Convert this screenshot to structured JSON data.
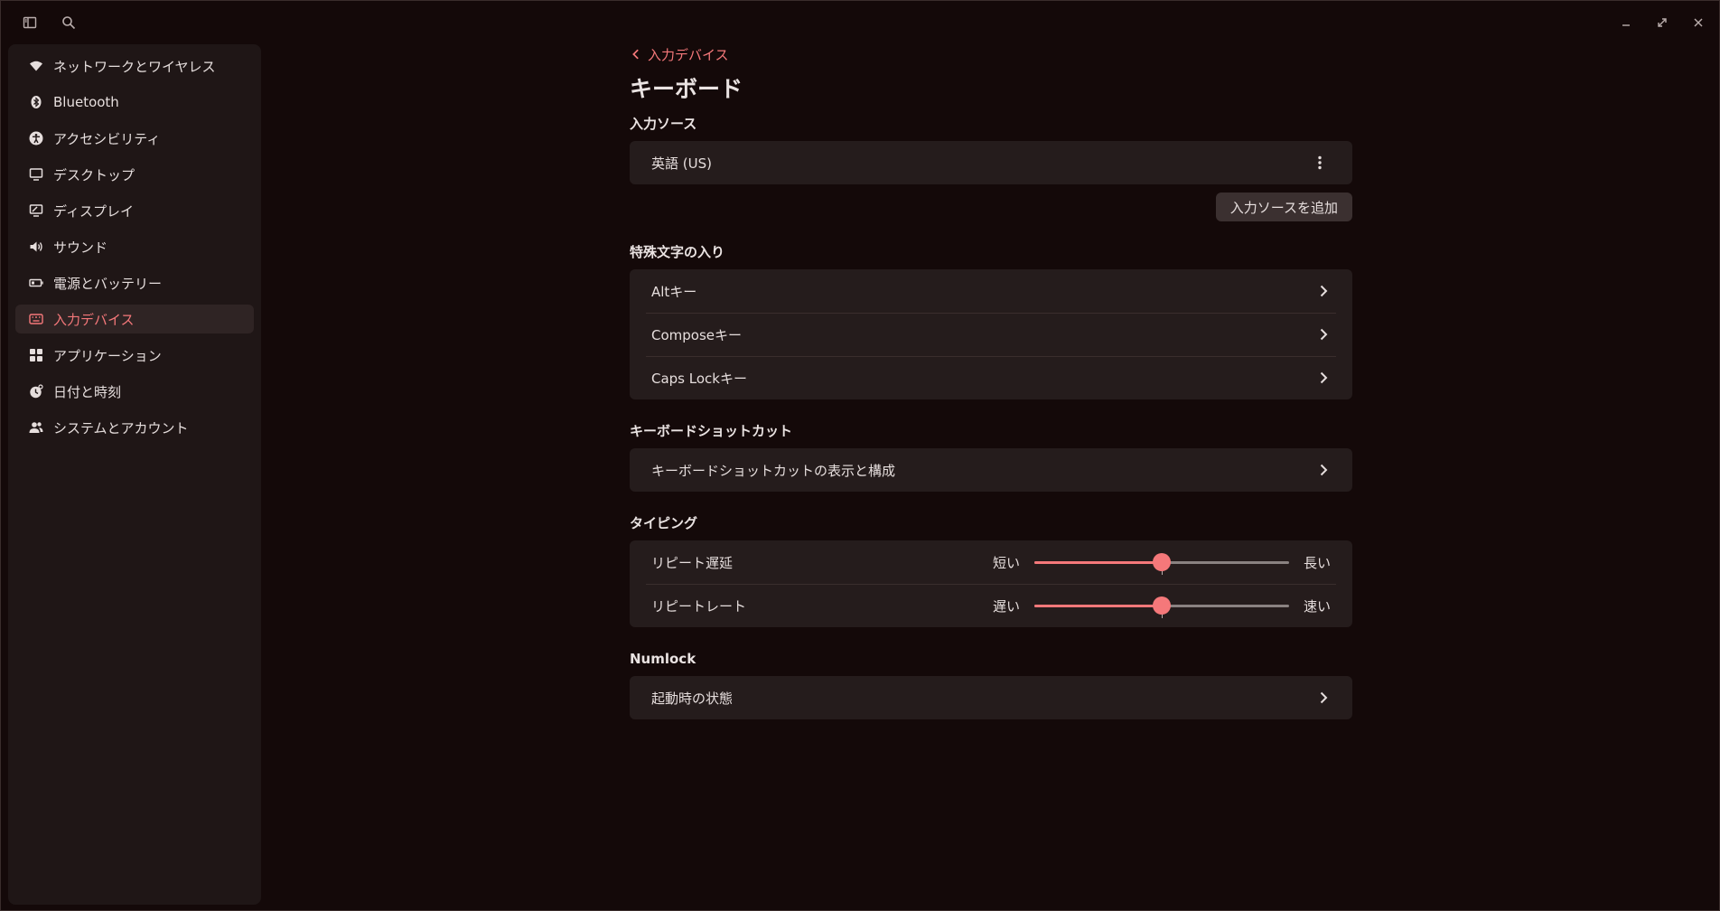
{
  "sidebar": {
    "items": [
      {
        "label": "ネットワークとワイヤレス",
        "icon": "wifi-icon"
      },
      {
        "label": "Bluetooth",
        "icon": "bluetooth-icon"
      },
      {
        "label": "アクセシビリティ",
        "icon": "accessibility-icon"
      },
      {
        "label": "デスクトップ",
        "icon": "desktop-icon"
      },
      {
        "label": "ディスプレイ",
        "icon": "display-icon"
      },
      {
        "label": "サウンド",
        "icon": "speaker-icon"
      },
      {
        "label": "電源とバッテリー",
        "icon": "battery-icon"
      },
      {
        "label": "入力デバイス",
        "icon": "keyboard-icon",
        "active": true
      },
      {
        "label": "アプリケーション",
        "icon": "apps-grid-icon"
      },
      {
        "label": "日付と時刻",
        "icon": "clock-icon"
      },
      {
        "label": "システムとアカウント",
        "icon": "users-icon"
      }
    ]
  },
  "colors": {
    "accent": "#f5787a",
    "background": "#140909",
    "sidebar": "#1f1616",
    "card": "#251c1c"
  },
  "header": {
    "back_label": "入力デバイス",
    "title": "キーボード"
  },
  "input_sources": {
    "title": "入力ソース",
    "items": [
      {
        "label": "英語 (US)"
      }
    ],
    "add_button": "入力ソースを追加"
  },
  "special_chars": {
    "title": "特殊文字の入り",
    "items": [
      {
        "label": "Altキー"
      },
      {
        "label": "Composeキー"
      },
      {
        "label": "Caps Lockキー"
      }
    ]
  },
  "shortcuts": {
    "title": "キーボードショットカット",
    "items": [
      {
        "label": "キーボードショットカットの表示と構成"
      }
    ]
  },
  "typing": {
    "title": "タイピング",
    "repeat_delay": {
      "label": "リピート遅延",
      "min": "短い",
      "max": "長い",
      "value": 0.5
    },
    "repeat_rate": {
      "label": "リピートレート",
      "min": "遅い",
      "max": "速い",
      "value": 0.5
    }
  },
  "numlock": {
    "title": "Numlock",
    "items": [
      {
        "label": "起動時の状態"
      }
    ]
  }
}
